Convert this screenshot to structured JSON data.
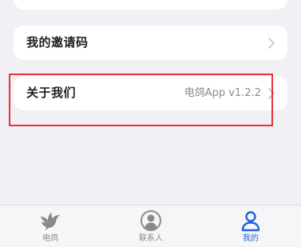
{
  "settings": {
    "invite_code_label": "我的邀请码",
    "about_label": "关于我们",
    "about_value": "电鸽App v1.2.2"
  },
  "tabbar": {
    "tabs": [
      {
        "label": "电鸽",
        "icon": "pigeon-icon",
        "active": false
      },
      {
        "label": "联系人",
        "icon": "contact-icon",
        "active": false
      },
      {
        "label": "我的",
        "icon": "user-icon",
        "active": true
      }
    ]
  },
  "colors": {
    "background": "#f0f0f5",
    "card": "#ffffff",
    "accent": "#2163d7",
    "highlight": "#e8333a",
    "muted": "#8a8a8a"
  }
}
